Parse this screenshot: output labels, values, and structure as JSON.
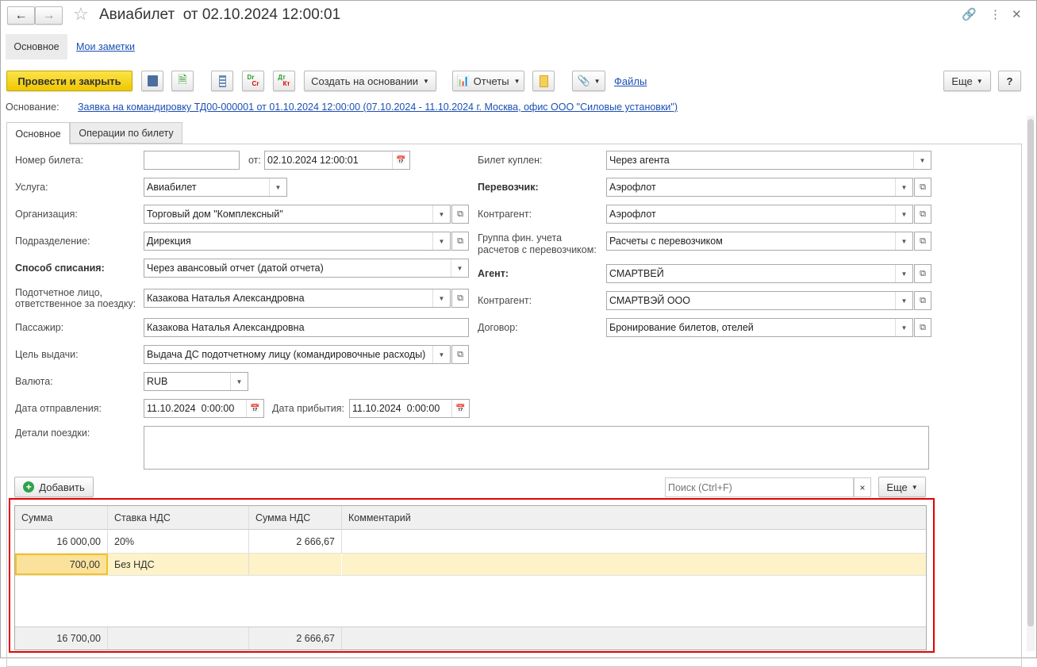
{
  "window": {
    "title": "Авиабилет  от 02.10.2024 12:00:01"
  },
  "nav": {
    "main": "Основное",
    "notes": "Мои заметки"
  },
  "toolbar": {
    "post_close": "Провести и закрыть",
    "create_based": "Создать на основании",
    "reports": "Отчеты",
    "files": "Файлы",
    "more": "Еще",
    "help": "?",
    "dr": "Dr",
    "cr": "Cr",
    "dt": "Дт",
    "kt": "Кт"
  },
  "basis": {
    "label": "Основание:",
    "value": "Заявка на командировку ТД00-000001 от 01.10.2024 12:00:00 (07.10.2024 - 11.10.2024 г. Москва, офис ООО \"Силовые установки\")"
  },
  "tabs": [
    "Основное",
    "Операции по билету"
  ],
  "left": {
    "ticket_no": {
      "label": "Номер билета:",
      "value": "",
      "from_label": "от:",
      "date": "02.10.2024 12:00:01"
    },
    "service": {
      "label": "Услуга:",
      "value": "Авиабилет"
    },
    "org": {
      "label": "Организация:",
      "value": "Торговый дом \"Комплексный\""
    },
    "dept": {
      "label": "Подразделение:",
      "value": "Дирекция"
    },
    "writeoff": {
      "label": "Способ списания:",
      "value": "Через авансовый отчет (датой отчета)"
    },
    "person": {
      "label1": "Подотчетное лицо,",
      "label2": "ответственное за поездку:",
      "value": "Казакова Наталья Александровна"
    },
    "passenger": {
      "label": "Пассажир:",
      "value": "Казакова Наталья Александровна"
    },
    "purpose": {
      "label": "Цель выдачи:",
      "value": "Выдача ДС подотчетному лицу (командировочные расходы)"
    },
    "currency": {
      "label": "Валюта:",
      "value": "RUB"
    },
    "depart": {
      "label": "Дата отправления:",
      "value": "11.10.2024  0:00:00"
    },
    "arrive": {
      "label": "Дата прибытия:",
      "value": "11.10.2024  0:00:00"
    },
    "details": {
      "label": "Детали поездки:",
      "value": ""
    }
  },
  "right": {
    "bought": {
      "label": "Билет куплен:",
      "value": "Через агента"
    },
    "carrier": {
      "label": "Перевозчик:",
      "value": "Аэрофлот"
    },
    "contractor1": {
      "label": "Контрагент:",
      "value": "Аэрофлот"
    },
    "group": {
      "label1": "Группа фин. учета",
      "label2": "расчетов с перевозчиком:",
      "value": "Расчеты с перевозчиком"
    },
    "agent": {
      "label": "Агент:",
      "value": "СМАРТВЕЙ"
    },
    "contractor2": {
      "label": "Контрагент:",
      "value": "СМАРТВЭЙ ООО"
    },
    "contract": {
      "label": "Договор:",
      "value": "Бронирование билетов, отелей"
    }
  },
  "table_bar": {
    "add": "Добавить",
    "search_placeholder": "Поиск (Ctrl+F)",
    "clear": "×",
    "more": "Еще"
  },
  "table": {
    "columns": [
      "Сумма",
      "Ставка НДС",
      "Сумма НДС",
      "Комментарий"
    ],
    "rows": [
      [
        "16 000,00",
        "20%",
        "2 666,67",
        ""
      ],
      [
        "700,00",
        "Без НДС",
        "",
        ""
      ]
    ],
    "footer": [
      "16 700,00",
      "",
      "2 666,67",
      ""
    ]
  },
  "colors": {
    "accent": "#f5d00f",
    "highlight": "#fdf2c8",
    "selected_cell": "#fbe29c",
    "frame": "#e60000",
    "link": "#1c4fb3"
  }
}
